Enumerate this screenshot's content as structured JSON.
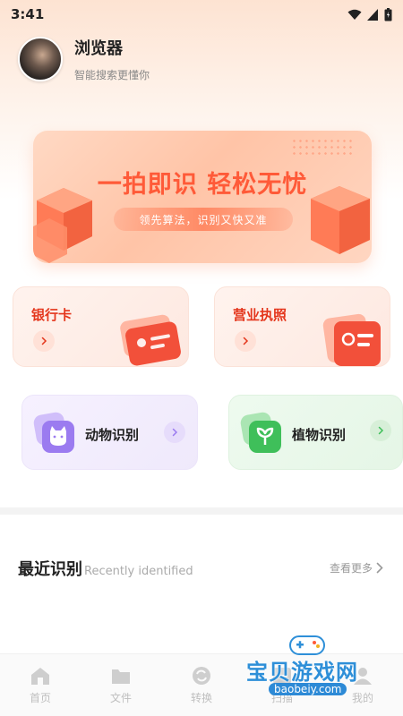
{
  "status_bar": {
    "time": "3:41",
    "icons": [
      "wifi-icon",
      "signal-icon",
      "battery-icon"
    ]
  },
  "profile": {
    "name": "浏览器",
    "subtitle": "智能搜索更懂你"
  },
  "banner": {
    "title": "一拍即识 轻松无忧",
    "subtitle": "领先算法，识别又快又准"
  },
  "cards": {
    "bank": {
      "title": "银行卡",
      "icon": "bank-card-icon"
    },
    "license": {
      "title": "营业执照",
      "icon": "license-icon"
    },
    "animal": {
      "title": "动物识别",
      "icon": "cat-icon"
    },
    "plant": {
      "title": "植物识别",
      "icon": "leaf-icon"
    }
  },
  "recent": {
    "title": "最近识别",
    "subtitle": "Recently identified",
    "more": "查看更多"
  },
  "tabbar": {
    "items": [
      {
        "label": "首页",
        "icon": "home-icon"
      },
      {
        "label": "文件",
        "icon": "folder-icon"
      },
      {
        "label": "转换",
        "icon": "convert-icon"
      },
      {
        "label": "扫描",
        "icon": "scan-icon"
      },
      {
        "label": "我的",
        "icon": "user-icon"
      }
    ]
  },
  "watermark": {
    "text": "宝贝游戏网",
    "url": "baobeiy.com"
  },
  "colors": {
    "accent": "#e4361c",
    "banner_text": "#ff5a38",
    "purple": "#9b7bf0",
    "green": "#3fbf5a"
  }
}
